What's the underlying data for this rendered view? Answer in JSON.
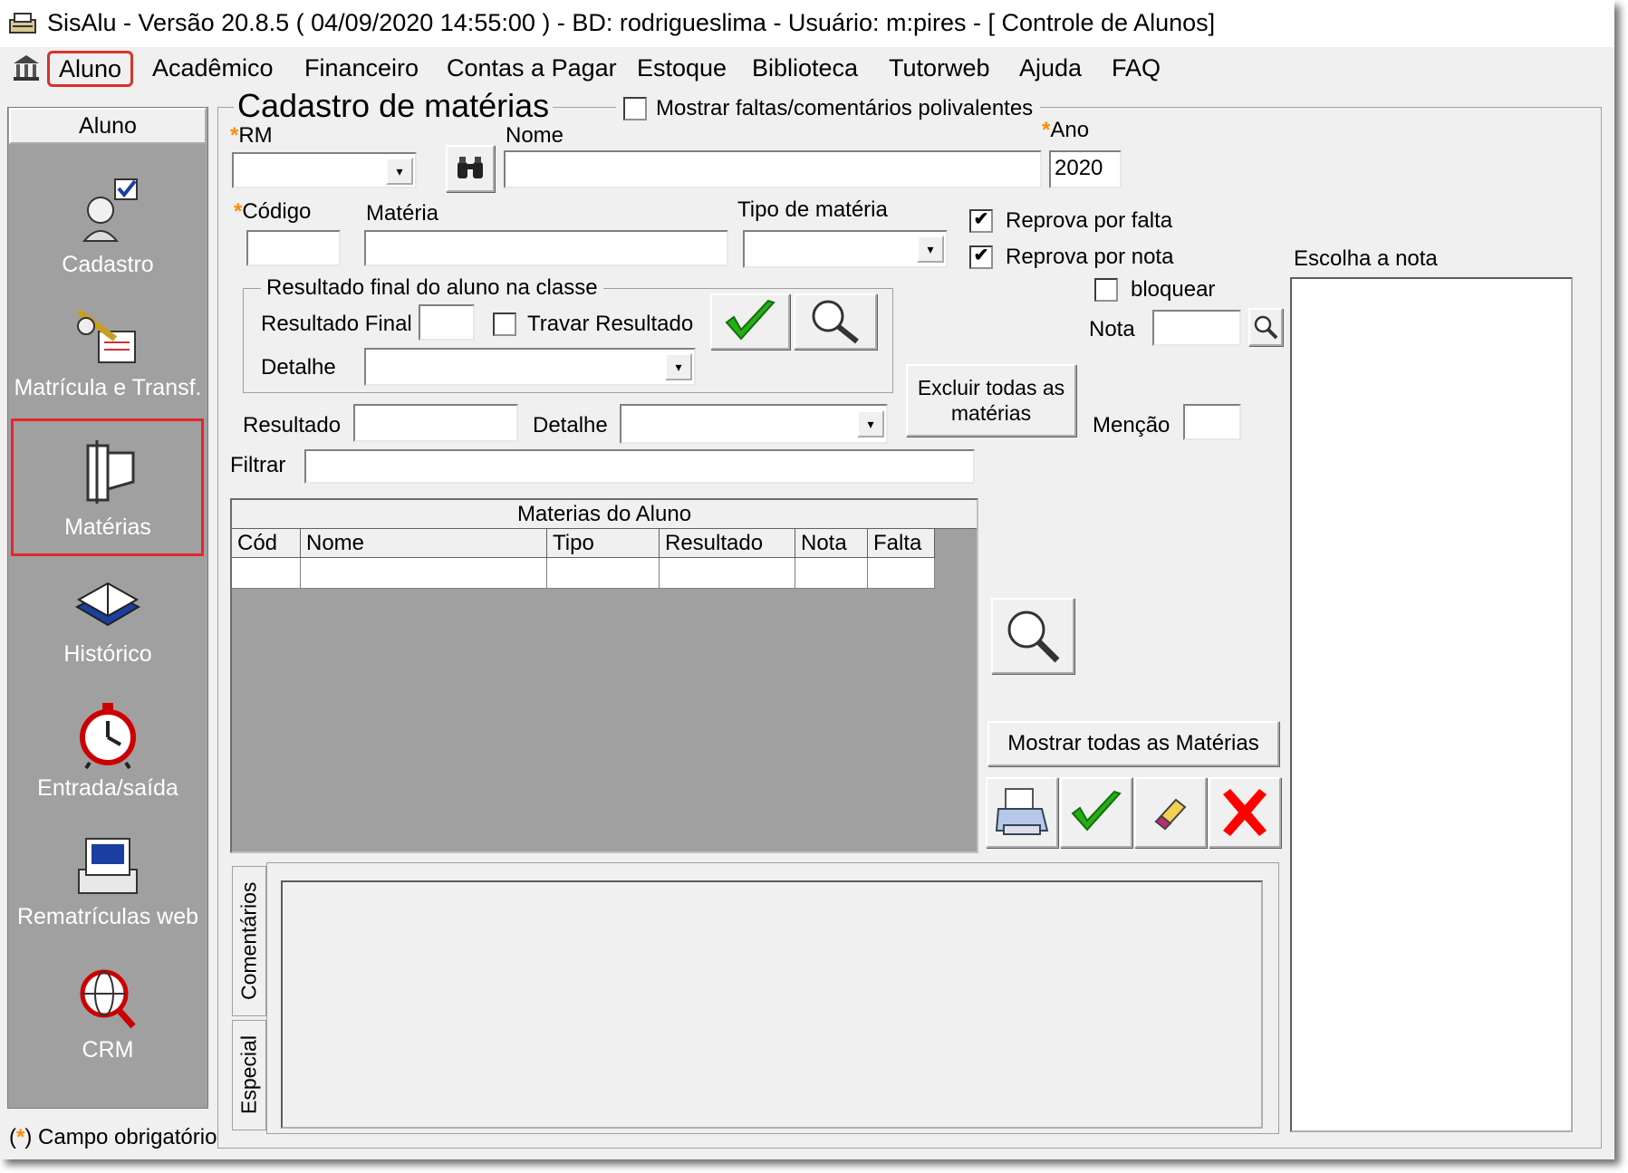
{
  "window": {
    "title": "SisAlu - Versão 20.8.5 ( 04/09/2020 14:55:00 ) - BD: rodrigueslima - Usuário: m:pires - [ Controle de Alunos]"
  },
  "menu": {
    "items": [
      "Aluno",
      "Acadêmico",
      "Financeiro",
      "Contas a Pagar",
      "Estoque",
      "Biblioteca",
      "Tutorweb",
      "Ajuda",
      "FAQ"
    ]
  },
  "sidebar": {
    "header": "Aluno",
    "items": [
      "Cadastro",
      "Matrícula e Transf.",
      "Matérias",
      "Histórico",
      "Entrada/saída",
      "Rematrículas web",
      "CRM"
    ],
    "selected": "Matérias"
  },
  "form": {
    "title": "Cadastro de matérias",
    "show_absences_label": "Mostrar faltas/comentários polivalentes",
    "required_mark": "*",
    "rm_label": "RM",
    "nome_label": "Nome",
    "ano_label": "Ano",
    "ano_value": "2020",
    "codigo_label": "Código",
    "materia_label": "Matéria",
    "tipo_label": "Tipo de matéria",
    "reprova_falta_label": "Reprova por falta",
    "reprova_nota_label": "Reprova por nota",
    "bloquear_label": "bloquear",
    "nota_label": "Nota",
    "mencao_label": "Menção",
    "escolha_nota_label": "Escolha a nota",
    "resultado_group_label": "Resultado final do aluno na classe",
    "resultado_final_label": "Resultado Final",
    "travar_label": "Travar Resultado",
    "detalhe_label": "Detalhe",
    "resultado_label": "Resultado",
    "detalhe2_label": "Detalhe",
    "excluir_button": "Excluir todas as matérias",
    "filtrar_label": "Filtrar",
    "check_mark": "✔"
  },
  "grid": {
    "caption": "Materias do Aluno",
    "columns": [
      "Cód",
      "Nome",
      "Tipo",
      "Resultado",
      "Nota",
      "Falta"
    ]
  },
  "buttons": {
    "show_all": "Mostrar todas as Matérias"
  },
  "tabs": [
    "Comentários",
    "Especial"
  ],
  "footer": {
    "mark": "*",
    "required_text": "Campo obrigatório"
  },
  "colors": {
    "sidebar": "#a0a0a0",
    "highlight": "#e5262c",
    "required": "#ff8c00",
    "ok_green": "#22b014",
    "cancel_red": "#ff0000"
  }
}
